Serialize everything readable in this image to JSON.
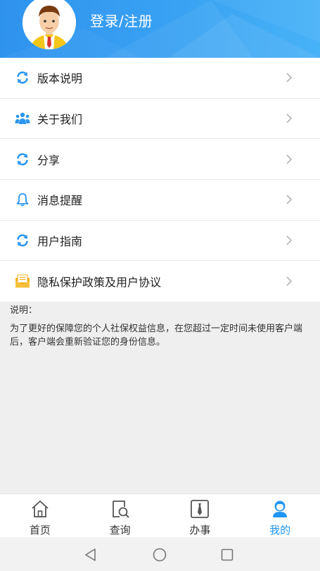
{
  "header": {
    "login_label": "登录/注册",
    "colors": {
      "start": "#2f93ee",
      "end": "#48b2f7"
    }
  },
  "menu": {
    "items": [
      {
        "label": "版本说明",
        "icon": "refresh-icon"
      },
      {
        "label": "关于我们",
        "icon": "people-icon"
      },
      {
        "label": "分享",
        "icon": "refresh-icon"
      },
      {
        "label": "消息提醒",
        "icon": "bell-icon"
      },
      {
        "label": "用户指南",
        "icon": "refresh-icon"
      },
      {
        "label": "隐私保护政策及用户协议",
        "icon": "envelope-icon"
      }
    ]
  },
  "note": {
    "title": "说明：",
    "body": "为了更好的保障您的个人社保权益信息，在您超过一定时间未使用客户端后，客户端会重新验证您的身份信息。"
  },
  "tabbar": {
    "tabs": [
      {
        "label": "首页",
        "icon": "home-icon",
        "active": false
      },
      {
        "label": "查询",
        "icon": "search-document-icon",
        "active": false
      },
      {
        "label": "办事",
        "icon": "tie-icon",
        "active": false
      },
      {
        "label": "我的",
        "icon": "user-icon",
        "active": true
      }
    ],
    "accent_color": "#2196f3"
  }
}
